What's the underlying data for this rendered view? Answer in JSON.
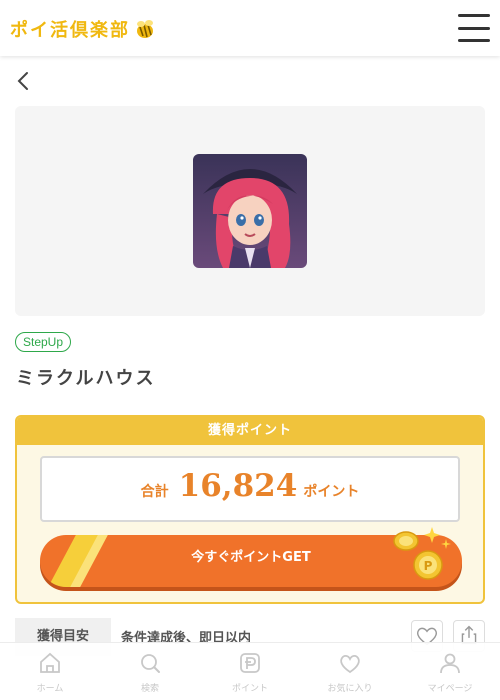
{
  "header": {
    "logo_text": "ポイ活倶楽部",
    "logo_icon": "bee-icon",
    "menu_icon": "hamburger-icon"
  },
  "nav_back_icon": "chevron-left-icon",
  "offer": {
    "tag": "StepUp",
    "title": "ミラクルハウス",
    "app_icon": "app-character-icon"
  },
  "points": {
    "header": "獲得ポイント",
    "total_label": "合計",
    "total_value": "16,824",
    "total_unit": "ポイント",
    "cta_label": "今すぐポイントGET"
  },
  "target": {
    "label": "獲得目安",
    "value": "条件達成後、即日以内"
  },
  "bottom_nav": {
    "items": [
      {
        "label": "ホーム",
        "icon": "home-icon"
      },
      {
        "label": "検索",
        "icon": "search-icon"
      },
      {
        "label": "ポイント",
        "icon": "point-icon"
      },
      {
        "label": "お気に入り",
        "icon": "heart-icon"
      },
      {
        "label": "マイページ",
        "icon": "user-icon"
      }
    ]
  },
  "colors": {
    "brand_yellow": "#f0c33c",
    "accent_orange": "#e8832a",
    "cta_orange": "#f0722a",
    "tag_green": "#2ea84a"
  }
}
